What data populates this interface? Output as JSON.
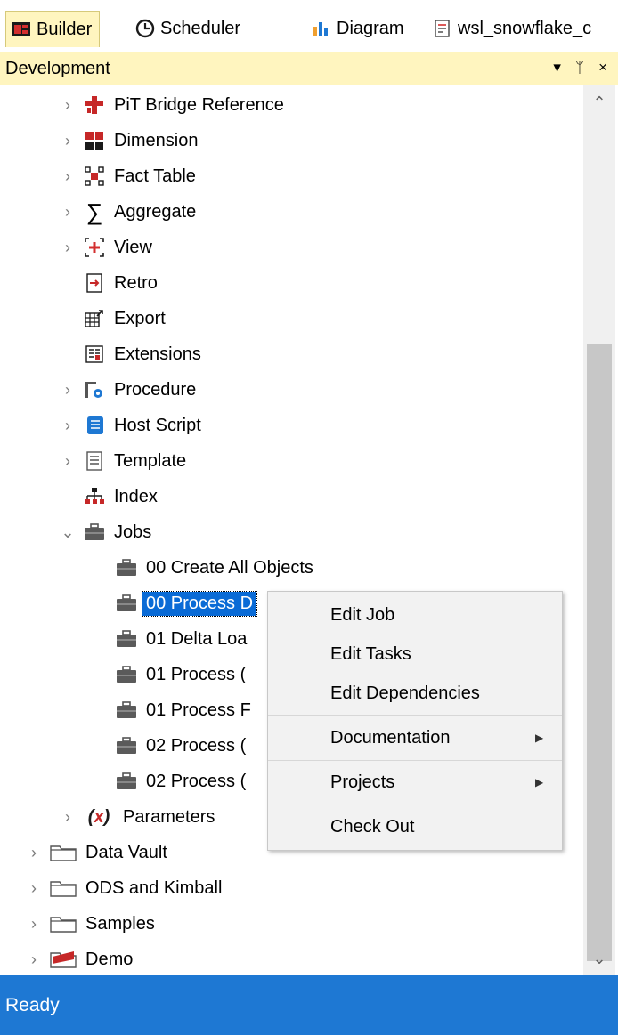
{
  "tabs": [
    {
      "label": "Builder",
      "icon": "builder-icon"
    },
    {
      "label": "Scheduler",
      "icon": "clock-icon"
    },
    {
      "label": "Diagram",
      "icon": "chart-icon"
    },
    {
      "label": "wsl_snowflake_c",
      "icon": "document-icon"
    }
  ],
  "pane": {
    "title": "Development",
    "controls": [
      "▾",
      "ᛘ",
      "×"
    ]
  },
  "tree": {
    "items": [
      {
        "label": "PiT Bridge Reference",
        "icon": "pit-bridge-icon"
      },
      {
        "label": "Dimension",
        "icon": "dimension-icon"
      },
      {
        "label": "Fact Table",
        "icon": "fact-table-icon"
      },
      {
        "label": "Aggregate",
        "icon": "sigma-icon"
      },
      {
        "label": "View",
        "icon": "view-icon"
      },
      {
        "label": "Retro",
        "icon": "retro-icon"
      },
      {
        "label": "Export",
        "icon": "export-icon"
      },
      {
        "label": "Extensions",
        "icon": "extensions-icon"
      },
      {
        "label": "Procedure",
        "icon": "procedure-icon"
      },
      {
        "label": "Host Script",
        "icon": "host-script-icon"
      },
      {
        "label": "Template",
        "icon": "template-icon"
      },
      {
        "label": "Index",
        "icon": "index-icon"
      },
      {
        "label": "Jobs",
        "icon": "jobs-icon"
      }
    ],
    "jobs": [
      {
        "label": "00 Create All Objects"
      },
      {
        "label": "00 Process D",
        "selected": true
      },
      {
        "label": "01 Delta Loa"
      },
      {
        "label": "01 Process ("
      },
      {
        "label": "01 Process F"
      },
      {
        "label": "02 Process ("
      },
      {
        "label": "02 Process ("
      }
    ],
    "parameters": {
      "label": "Parameters",
      "icon": "parameters-icon"
    },
    "projects": [
      {
        "label": "Data Vault",
        "icon": "folder-icon"
      },
      {
        "label": "ODS and Kimball",
        "icon": "folder-icon"
      },
      {
        "label": "Samples",
        "icon": "folder-icon"
      },
      {
        "label": "Demo",
        "icon": "folder-icon-red"
      }
    ]
  },
  "context_menu": {
    "items": [
      {
        "label": "Edit Job"
      },
      {
        "label": "Edit Tasks"
      },
      {
        "label": "Edit Dependencies"
      },
      {
        "label": "Documentation",
        "submenu": true
      },
      {
        "label": "Projects",
        "submenu": true
      },
      {
        "label": "Check Out"
      }
    ]
  },
  "status": {
    "text": "Ready"
  },
  "colors": {
    "accent": "#1e78d3",
    "tab_active": "#fff5bf",
    "selection": "#0a6bd6"
  }
}
